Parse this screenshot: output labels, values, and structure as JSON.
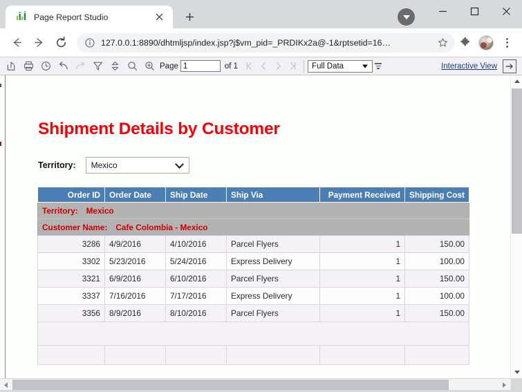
{
  "browser": {
    "tab": {
      "title": "Page Report Studio",
      "favicon_icon": "bar-chart-favicon",
      "close_icon": "close-icon"
    },
    "new_tab_icon": "plus-icon",
    "window_controls": {
      "profile_caret_icon": "chevron-down-icon",
      "minimize_icon": "minimize-icon",
      "maximize_icon": "maximize-icon",
      "close_icon": "close-icon"
    },
    "nav": {
      "back_icon": "arrow-left-icon",
      "forward_icon": "arrow-right-icon",
      "reload_icon": "reload-icon"
    },
    "omnibox": {
      "info_icon": "info-circle-icon",
      "url": "127.0.0.1:8890/dhtmljsp/index.jsp?j$vm_pid=_PRDIKx2a@-1&rptsetid=16…",
      "star_icon": "bookmark-star-icon"
    },
    "extensions_icon": "puzzle-piece-icon",
    "avatar_name": "user-avatar",
    "menu_icon": "kebab-menu-icon"
  },
  "toolbar": {
    "buttons": [
      {
        "name": "export-button",
        "icon": "export-share-icon",
        "disabled": false
      },
      {
        "name": "print-button",
        "icon": "printer-icon",
        "disabled": false
      },
      {
        "name": "history-button",
        "icon": "clock-icon",
        "disabled": false
      },
      {
        "name": "undo-button",
        "icon": "undo-arrow-icon",
        "disabled": false
      },
      {
        "name": "redo-button",
        "icon": "redo-arrow-icon",
        "disabled": true
      },
      {
        "name": "filter-button",
        "icon": "funnel-filter-icon",
        "disabled": false
      },
      {
        "name": "sort-button",
        "icon": "sort-diamond-icon",
        "disabled": false
      },
      {
        "name": "search-button",
        "icon": "magnifier-icon",
        "disabled": false
      },
      {
        "name": "zoom-button",
        "icon": "magnifier-plus-icon",
        "disabled": false
      }
    ],
    "page_label": "Page",
    "page_value": "1",
    "page_of": "of 1",
    "first_page_icon": "first-page-icon",
    "prev_page_icon": "prev-page-icon",
    "next_page_icon": "next-page-icon",
    "last_page_icon": "last-page-icon",
    "data_mode": "Full Data",
    "data_mode_caret_icon": "dropdown-caret-icon",
    "lines_icon": "data-lines-icon",
    "interactive_view": "Interactive View",
    "exit_icon": "exit-arrow-icon"
  },
  "report": {
    "title": "Shipment Details by Customer",
    "title_color": "#fb0007",
    "prompt": {
      "label": "Territory:",
      "value": "Mexico",
      "chevron_icon": "chevron-down-icon"
    },
    "table": {
      "header_bg": "#4a7eb5",
      "columns": [
        {
          "label": "Order ID",
          "align": "right"
        },
        {
          "label": "Order Date",
          "align": "left"
        },
        {
          "label": "Ship Date",
          "align": "left"
        },
        {
          "label": "Ship Via",
          "align": "left"
        },
        {
          "label": "Payment Received",
          "align": "right"
        },
        {
          "label": "Shipping Cost",
          "align": "right"
        }
      ],
      "group_territory_label": "Territory:",
      "group_territory_value": "Mexico",
      "group_customer_label": "Customer Name:",
      "group_customer_value": "Cafe Colombia - Mexico",
      "rows": [
        {
          "order_id": "3286",
          "order_date": "4/9/2016",
          "ship_date": "4/10/2016",
          "ship_via": "Parcel Flyers",
          "payment_received": "1",
          "shipping_cost": "150.00"
        },
        {
          "order_id": "3302",
          "order_date": "5/23/2016",
          "ship_date": "5/24/2016",
          "ship_via": "Express Delivery",
          "payment_received": "1",
          "shipping_cost": "100.00"
        },
        {
          "order_id": "3321",
          "order_date": "6/9/2016",
          "ship_date": "6/10/2016",
          "ship_via": "Parcel Flyers",
          "payment_received": "1",
          "shipping_cost": "150.00"
        },
        {
          "order_id": "3337",
          "order_date": "7/16/2016",
          "ship_date": "7/17/2016",
          "ship_via": "Express Delivery",
          "payment_received": "1",
          "shipping_cost": "100.00"
        },
        {
          "order_id": "3356",
          "order_date": "8/9/2016",
          "ship_date": "8/10/2016",
          "ship_via": "Parcel Flyers",
          "payment_received": "1",
          "shipping_cost": "150.00"
        }
      ]
    }
  },
  "scrollbars": {
    "v_up_icon": "scroll-up-arrow-icon",
    "v_down_icon": "scroll-down-arrow-icon",
    "h_left_icon": "scroll-left-arrow-icon",
    "h_right_icon": "scroll-right-arrow-icon"
  }
}
